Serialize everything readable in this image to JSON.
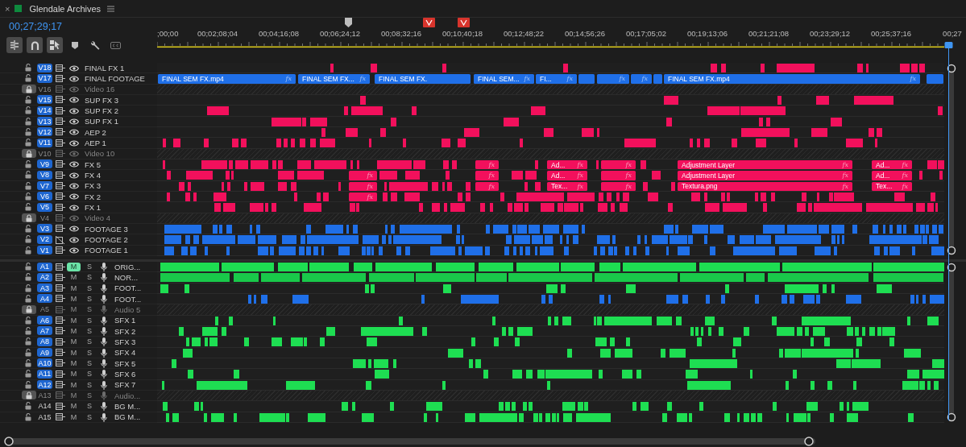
{
  "panel": {
    "close": "×",
    "title": "Glendale Archives"
  },
  "timecode": "00;27;29;17",
  "tools": [
    {
      "kind": "split",
      "on": true
    },
    {
      "kind": "snap",
      "on": true
    },
    {
      "kind": "linked",
      "on": true
    },
    {
      "kind": "marker",
      "on": false
    },
    {
      "kind": "wrench",
      "on": false
    },
    {
      "kind": "captions",
      "on": false
    }
  ],
  "ruler": {
    "labels": [
      ";00;00",
      "00;02;08;04",
      "00;04;16;08",
      "00;06;24;12",
      "00;08;32;16",
      "00;10;40;18",
      "00;12;48;22",
      "00;14;56;26",
      "00;17;05;02",
      "00;19;13;06",
      "00;21;21;08",
      "00;23;29;12",
      "00;25;37;16",
      "00;27"
    ]
  },
  "video_tracks": [
    {
      "id": "V18",
      "name": "FINAL FX 1",
      "targeted": true,
      "locked": false,
      "sync": true,
      "color": "#f2105c"
    },
    {
      "id": "V17",
      "name": "FINAL FOOTAGE",
      "targeted": true,
      "locked": false,
      "sync": true,
      "color": "#1f6fe8",
      "clips": [
        {
          "label": "FINAL SEM FX.mp4",
          "effect": "fx"
        },
        {
          "label": "FINAL SEM FX...",
          "effect": "fx"
        },
        {
          "label": "FINAL SEM FX."
        },
        {
          "label": "FINAL SEM...",
          "effect": "fx"
        },
        {
          "label": "FI...",
          "effect": "fx"
        },
        {
          "effect": "fx"
        },
        {
          "effect": "fx"
        },
        {
          "label": "FINAL SEM FX.mp4",
          "effect": "fx"
        }
      ]
    },
    {
      "id": "V16",
      "name": "Video 16",
      "targeted": false,
      "locked": true,
      "sync": true
    },
    {
      "id": "V15",
      "name": "SUP FX 3",
      "targeted": true,
      "locked": false,
      "sync": true,
      "color": "#f2105c"
    },
    {
      "id": "V14",
      "name": "SUP FX 2",
      "targeted": true,
      "locked": false,
      "sync": true,
      "color": "#f2105c"
    },
    {
      "id": "V13",
      "name": "SUP FX 1",
      "targeted": true,
      "locked": false,
      "sync": true,
      "color": "#f2105c"
    },
    {
      "id": "V12",
      "name": "AEP 2",
      "targeted": true,
      "locked": false,
      "sync": true,
      "color": "#f2105c"
    },
    {
      "id": "V11",
      "name": "AEP 1",
      "targeted": true,
      "locked": false,
      "sync": true,
      "color": "#f2105c"
    },
    {
      "id": "V10",
      "name": "Video 10",
      "targeted": false,
      "locked": true,
      "sync": true
    },
    {
      "id": "V9",
      "name": "FX 5",
      "targeted": true,
      "locked": false,
      "sync": true,
      "color": "#f2105c",
      "clips": [
        {
          "effect": "fx"
        },
        {
          "label": "Ad...",
          "effect": "fx"
        },
        {
          "effect": "fx"
        },
        {
          "label": "Adjustment Layer",
          "effect": "fx"
        },
        {
          "label": "Ad...",
          "effect": "fx"
        }
      ]
    },
    {
      "id": "V8",
      "name": "FX 4",
      "targeted": true,
      "locked": false,
      "sync": true,
      "color": "#f2105c",
      "clips": [
        {
          "effect": "fx"
        },
        {
          "effect": "fx"
        },
        {
          "label": "Ad...",
          "effect": "fx"
        },
        {
          "effect": "fx"
        },
        {
          "label": "Adjustment Layer",
          "effect": "fx"
        },
        {
          "label": "Ad...",
          "effect": "fx"
        }
      ]
    },
    {
      "id": "V7",
      "name": "FX 3",
      "targeted": true,
      "locked": false,
      "sync": true,
      "color": "#f2105c",
      "clips": [
        {
          "effect": "fx"
        },
        {
          "effect": "fx"
        },
        {
          "label": "Tex...",
          "effect": "fx"
        },
        {
          "effect": "fx"
        },
        {
          "label": "Textura.png",
          "effect": "fx"
        },
        {
          "label": "Tex...",
          "effect": "fx"
        }
      ]
    },
    {
      "id": "V6",
      "name": "FX 2",
      "targeted": true,
      "locked": false,
      "sync": true,
      "color": "#f2105c",
      "clips": [
        {
          "effect": "fx"
        }
      ]
    },
    {
      "id": "V5",
      "name": "FX 1",
      "targeted": true,
      "locked": false,
      "sync": true,
      "color": "#f2105c"
    },
    {
      "id": "V4",
      "name": "Video 4",
      "targeted": false,
      "locked": true,
      "sync": true
    },
    {
      "id": "V3",
      "name": "FOOTAGE 3",
      "targeted": true,
      "locked": false,
      "sync": true,
      "color": "#1f6fe8"
    },
    {
      "id": "V2",
      "name": "FOOTAGE 2",
      "targeted": true,
      "locked": false,
      "sync": false,
      "color": "#1f6fe8"
    },
    {
      "id": "V1",
      "name": "FOOTAGE 1",
      "targeted": true,
      "locked": false,
      "sync": true,
      "color": "#1f6fe8"
    }
  ],
  "audio_tracks": [
    {
      "id": "A1",
      "name": "ORIG...",
      "targeted": true,
      "locked": false,
      "mute_label": "M",
      "muted": true,
      "solo_label": "S",
      "color": "#1ede52"
    },
    {
      "id": "A2",
      "name": "NOR...",
      "targeted": true,
      "locked": false,
      "mute_label": "M",
      "muted": false,
      "solo_label": "S",
      "color": "#19c94a"
    },
    {
      "id": "A3",
      "name": "FOOT...",
      "targeted": true,
      "locked": false,
      "mute_label": "M",
      "muted": false,
      "solo_label": "S",
      "color": "#1ede52"
    },
    {
      "id": "A4",
      "name": "FOOT...",
      "targeted": true,
      "locked": false,
      "mute_label": "M",
      "muted": false,
      "solo_label": "S",
      "color": "#1f6fe8"
    },
    {
      "id": "A5",
      "name": "Audio 5",
      "targeted": false,
      "locked": true,
      "mute_label": "M",
      "muted": false,
      "solo_label": "S"
    },
    {
      "id": "A6",
      "name": "SFX 1",
      "targeted": true,
      "locked": false,
      "mute_label": "M",
      "muted": false,
      "solo_label": "S",
      "color": "#1ede52"
    },
    {
      "id": "A7",
      "name": "SFX 2",
      "targeted": true,
      "locked": false,
      "mute_label": "M",
      "muted": false,
      "solo_label": "S",
      "color": "#1ede52"
    },
    {
      "id": "A8",
      "name": "SFX 3",
      "targeted": true,
      "locked": false,
      "mute_label": "M",
      "muted": false,
      "solo_label": "S",
      "color": "#1ede52"
    },
    {
      "id": "A9",
      "name": "SFX 4",
      "targeted": true,
      "locked": false,
      "mute_label": "M",
      "muted": false,
      "solo_label": "S",
      "color": "#1ede52"
    },
    {
      "id": "A10",
      "name": "SFX 5",
      "targeted": true,
      "locked": false,
      "mute_label": "M",
      "muted": false,
      "solo_label": "S",
      "color": "#1ede52"
    },
    {
      "id": "A11",
      "name": "SFX 6",
      "targeted": true,
      "locked": false,
      "mute_label": "M",
      "muted": false,
      "solo_label": "S",
      "color": "#1ede52"
    },
    {
      "id": "A12",
      "name": "SFX 7",
      "targeted": true,
      "locked": false,
      "mute_label": "M",
      "muted": false,
      "solo_label": "S",
      "color": "#1ede52"
    },
    {
      "id": "A13",
      "name": "Audio...",
      "targeted": false,
      "locked": true,
      "mute_label": "M",
      "muted": false,
      "solo_label": "S"
    },
    {
      "id": "A14",
      "name": "BG M...",
      "targeted": false,
      "locked": false,
      "mute_label": "M",
      "muted": false,
      "solo_label": "S",
      "color": "#1ede52"
    },
    {
      "id": "A15",
      "name": "BG M...",
      "targeted": false,
      "locked": false,
      "mute_label": "M",
      "muted": false,
      "solo_label": "S",
      "color": "#1ede52"
    }
  ]
}
